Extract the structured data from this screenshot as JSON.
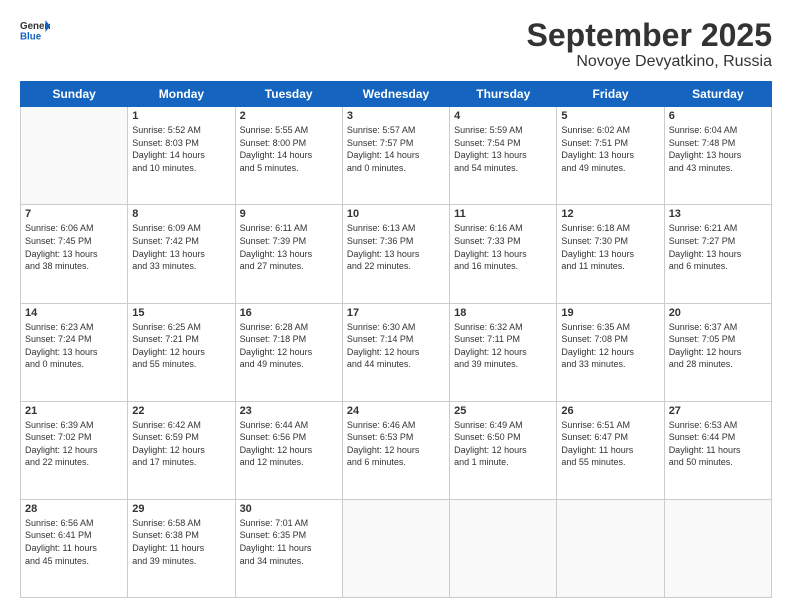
{
  "logo": {
    "line1": "General",
    "line2": "Blue"
  },
  "title": "September 2025",
  "subtitle": "Novoye Devyatkino, Russia",
  "weekdays": [
    "Sunday",
    "Monday",
    "Tuesday",
    "Wednesday",
    "Thursday",
    "Friday",
    "Saturday"
  ],
  "weeks": [
    [
      {
        "day": "",
        "info": ""
      },
      {
        "day": "1",
        "info": "Sunrise: 5:52 AM\nSunset: 8:03 PM\nDaylight: 14 hours\nand 10 minutes."
      },
      {
        "day": "2",
        "info": "Sunrise: 5:55 AM\nSunset: 8:00 PM\nDaylight: 14 hours\nand 5 minutes."
      },
      {
        "day": "3",
        "info": "Sunrise: 5:57 AM\nSunset: 7:57 PM\nDaylight: 14 hours\nand 0 minutes."
      },
      {
        "day": "4",
        "info": "Sunrise: 5:59 AM\nSunset: 7:54 PM\nDaylight: 13 hours\nand 54 minutes."
      },
      {
        "day": "5",
        "info": "Sunrise: 6:02 AM\nSunset: 7:51 PM\nDaylight: 13 hours\nand 49 minutes."
      },
      {
        "day": "6",
        "info": "Sunrise: 6:04 AM\nSunset: 7:48 PM\nDaylight: 13 hours\nand 43 minutes."
      }
    ],
    [
      {
        "day": "7",
        "info": "Sunrise: 6:06 AM\nSunset: 7:45 PM\nDaylight: 13 hours\nand 38 minutes."
      },
      {
        "day": "8",
        "info": "Sunrise: 6:09 AM\nSunset: 7:42 PM\nDaylight: 13 hours\nand 33 minutes."
      },
      {
        "day": "9",
        "info": "Sunrise: 6:11 AM\nSunset: 7:39 PM\nDaylight: 13 hours\nand 27 minutes."
      },
      {
        "day": "10",
        "info": "Sunrise: 6:13 AM\nSunset: 7:36 PM\nDaylight: 13 hours\nand 22 minutes."
      },
      {
        "day": "11",
        "info": "Sunrise: 6:16 AM\nSunset: 7:33 PM\nDaylight: 13 hours\nand 16 minutes."
      },
      {
        "day": "12",
        "info": "Sunrise: 6:18 AM\nSunset: 7:30 PM\nDaylight: 13 hours\nand 11 minutes."
      },
      {
        "day": "13",
        "info": "Sunrise: 6:21 AM\nSunset: 7:27 PM\nDaylight: 13 hours\nand 6 minutes."
      }
    ],
    [
      {
        "day": "14",
        "info": "Sunrise: 6:23 AM\nSunset: 7:24 PM\nDaylight: 13 hours\nand 0 minutes."
      },
      {
        "day": "15",
        "info": "Sunrise: 6:25 AM\nSunset: 7:21 PM\nDaylight: 12 hours\nand 55 minutes."
      },
      {
        "day": "16",
        "info": "Sunrise: 6:28 AM\nSunset: 7:18 PM\nDaylight: 12 hours\nand 49 minutes."
      },
      {
        "day": "17",
        "info": "Sunrise: 6:30 AM\nSunset: 7:14 PM\nDaylight: 12 hours\nand 44 minutes."
      },
      {
        "day": "18",
        "info": "Sunrise: 6:32 AM\nSunset: 7:11 PM\nDaylight: 12 hours\nand 39 minutes."
      },
      {
        "day": "19",
        "info": "Sunrise: 6:35 AM\nSunset: 7:08 PM\nDaylight: 12 hours\nand 33 minutes."
      },
      {
        "day": "20",
        "info": "Sunrise: 6:37 AM\nSunset: 7:05 PM\nDaylight: 12 hours\nand 28 minutes."
      }
    ],
    [
      {
        "day": "21",
        "info": "Sunrise: 6:39 AM\nSunset: 7:02 PM\nDaylight: 12 hours\nand 22 minutes."
      },
      {
        "day": "22",
        "info": "Sunrise: 6:42 AM\nSunset: 6:59 PM\nDaylight: 12 hours\nand 17 minutes."
      },
      {
        "day": "23",
        "info": "Sunrise: 6:44 AM\nSunset: 6:56 PM\nDaylight: 12 hours\nand 12 minutes."
      },
      {
        "day": "24",
        "info": "Sunrise: 6:46 AM\nSunset: 6:53 PM\nDaylight: 12 hours\nand 6 minutes."
      },
      {
        "day": "25",
        "info": "Sunrise: 6:49 AM\nSunset: 6:50 PM\nDaylight: 12 hours\nand 1 minute."
      },
      {
        "day": "26",
        "info": "Sunrise: 6:51 AM\nSunset: 6:47 PM\nDaylight: 11 hours\nand 55 minutes."
      },
      {
        "day": "27",
        "info": "Sunrise: 6:53 AM\nSunset: 6:44 PM\nDaylight: 11 hours\nand 50 minutes."
      }
    ],
    [
      {
        "day": "28",
        "info": "Sunrise: 6:56 AM\nSunset: 6:41 PM\nDaylight: 11 hours\nand 45 minutes."
      },
      {
        "day": "29",
        "info": "Sunrise: 6:58 AM\nSunset: 6:38 PM\nDaylight: 11 hours\nand 39 minutes."
      },
      {
        "day": "30",
        "info": "Sunrise: 7:01 AM\nSunset: 6:35 PM\nDaylight: 11 hours\nand 34 minutes."
      },
      {
        "day": "",
        "info": ""
      },
      {
        "day": "",
        "info": ""
      },
      {
        "day": "",
        "info": ""
      },
      {
        "day": "",
        "info": ""
      }
    ]
  ]
}
